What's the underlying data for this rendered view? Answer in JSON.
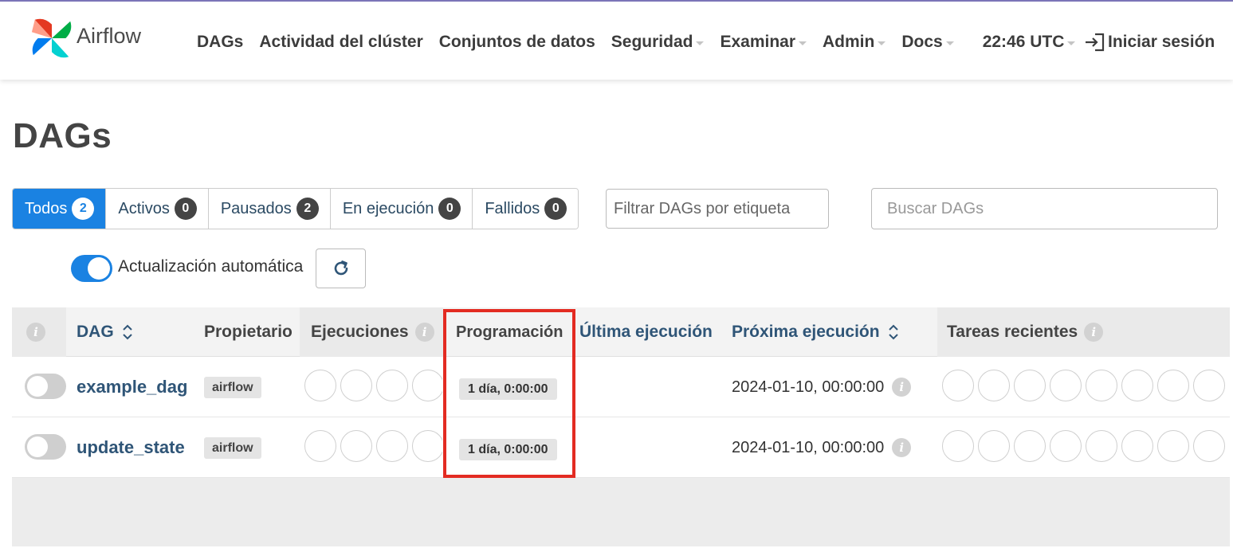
{
  "brand": {
    "name": "Airflow"
  },
  "nav": {
    "items": [
      {
        "label": "DAGs",
        "dropdown": false
      },
      {
        "label": "Actividad del clúster",
        "dropdown": false
      },
      {
        "label": "Conjuntos de datos",
        "dropdown": false
      },
      {
        "label": "Seguridad",
        "dropdown": true
      },
      {
        "label": "Examinar",
        "dropdown": true
      },
      {
        "label": "Admin",
        "dropdown": true
      },
      {
        "label": "Docs",
        "dropdown": true
      }
    ],
    "time": "22:46 UTC",
    "login": "Iniciar sesión"
  },
  "page": {
    "title": "DAGs"
  },
  "filters": [
    {
      "label": "Todos",
      "count": "2",
      "active": true
    },
    {
      "label": "Activos",
      "count": "0",
      "active": false
    },
    {
      "label": "Pausados",
      "count": "2",
      "active": false
    },
    {
      "label": "En ejecución",
      "count": "0",
      "active": false
    },
    {
      "label": "Fallidos",
      "count": "0",
      "active": false
    }
  ],
  "tag_filter": {
    "placeholder": "Filtrar DAGs por etiqueta"
  },
  "search": {
    "placeholder": "Buscar DAGs"
  },
  "auto_refresh": {
    "label": "Actualización automática",
    "enabled": true
  },
  "table": {
    "headers": {
      "dag": "DAG",
      "owner": "Propietario",
      "runs": "Ejecuciones",
      "schedule": "Programación",
      "last_run": "Última ejecución",
      "next_run": "Próxima ejecución",
      "recent_tasks": "Tareas recientes"
    },
    "rows": [
      {
        "dag_id": "example_dag",
        "owner": "airflow",
        "schedule": "1 día, 0:00:00",
        "next_run": "2024-01-10, 00:00:00",
        "paused": true
      },
      {
        "dag_id": "update_state",
        "owner": "airflow",
        "schedule": "1 día, 0:00:00",
        "next_run": "2024-01-10, 00:00:00",
        "paused": true
      }
    ]
  },
  "colors": {
    "primary": "#1a82e2",
    "link": "#2f5577",
    "highlight": "#e32b22"
  }
}
